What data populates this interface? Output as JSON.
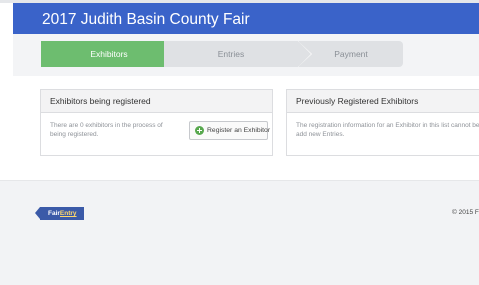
{
  "header": {
    "title": "2017 Judith Basin County Fair"
  },
  "steps": [
    {
      "label": "Exhibitors",
      "active": true
    },
    {
      "label": "Entries",
      "active": false
    },
    {
      "label": "Payment",
      "active": false
    }
  ],
  "panels": {
    "registering": {
      "title": "Exhibitors being registered",
      "body": "There are 0 exhibitors in the process of being registered.",
      "button_label": "Register an Exhibitor",
      "button_icon": "plus-circle-icon"
    },
    "previous": {
      "title": "Previously Registered Exhibitors",
      "body_line1": "The registration information for an Exhibitor in this list cannot be edited",
      "body_line2": "add new Entries."
    }
  },
  "footer": {
    "logo_part1": "Fair",
    "logo_part2": "Entry",
    "copyright": "© 2015 F"
  },
  "colors": {
    "header": "#3a63c9",
    "active_step": "#6dbd6f",
    "inactive_step": "#dfe1e4",
    "logo": "#3b5aa8"
  }
}
